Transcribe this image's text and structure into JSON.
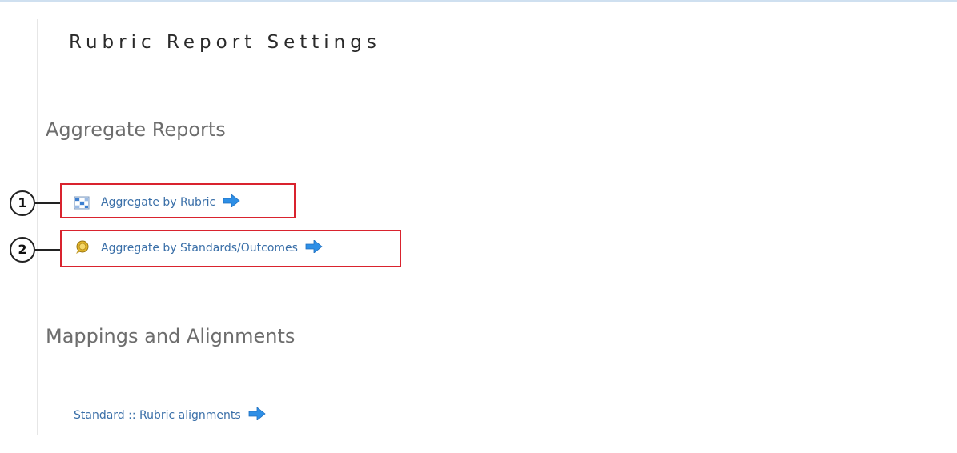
{
  "page": {
    "title": "Rubric Report Settings"
  },
  "sections": [
    {
      "heading": "Aggregate Reports",
      "links": [
        {
          "label": "Aggregate by Rubric",
          "icon": "rubric-grid-icon",
          "callout": "1"
        },
        {
          "label": "Aggregate by Standards/Outcomes",
          "icon": "standards-badge-icon",
          "callout": "2"
        }
      ]
    },
    {
      "heading": "Mappings and Alignments",
      "links": [
        {
          "label": "Standard :: Rubric alignments"
        }
      ]
    }
  ],
  "colors": {
    "link": "#3a6fa8",
    "heading": "#6d6d6d",
    "highlight_border": "#d9232e",
    "arrow": "#2e8fe6"
  }
}
